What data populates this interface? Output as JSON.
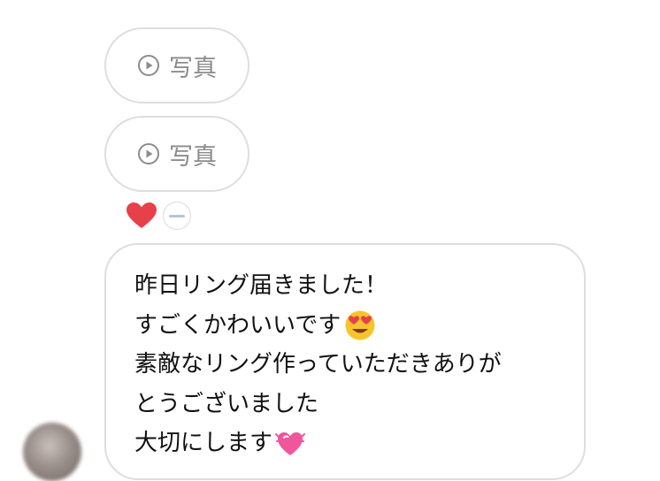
{
  "messages": {
    "photo_label": "写真",
    "text_lines": [
      "昨日リング届きました！",
      "すごくかわいいです",
      "素敵なリング作っていただきありが",
      "とうございました",
      "大切にします"
    ]
  },
  "icons": {
    "play": "play-circle-icon",
    "reaction_heart": "heart-icon",
    "emoji_face": "heart-eyes-emoji",
    "emoji_heart": "sparkling-heart-emoji"
  },
  "colors": {
    "bubble_border": "#dedede",
    "photo_text": "#8c8c8c",
    "message_text": "#111111",
    "heart": "#e8404a",
    "pink_heart": "#f1559c"
  }
}
